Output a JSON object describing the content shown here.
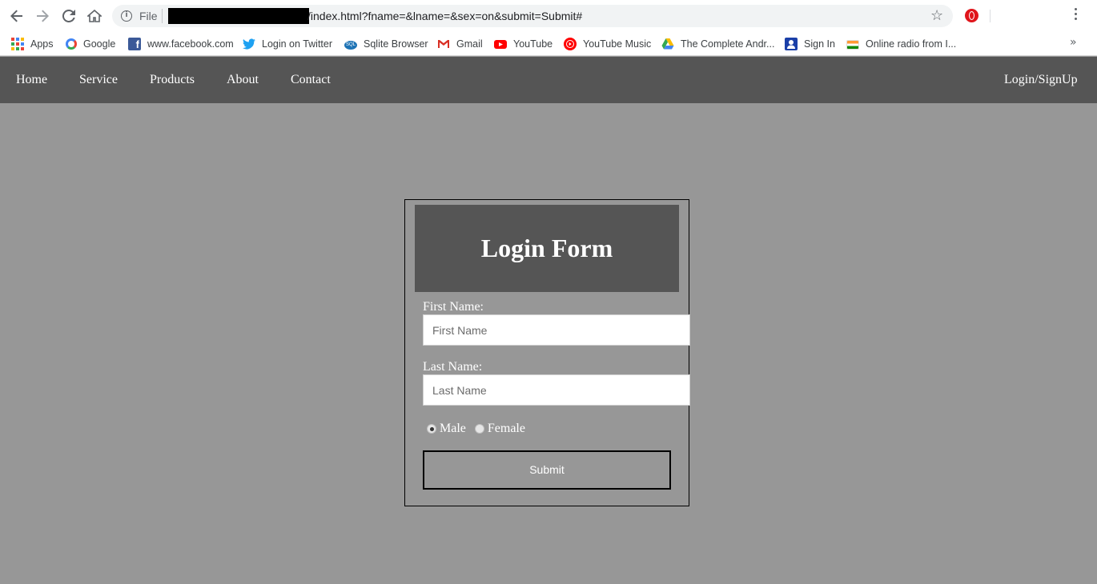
{
  "browser": {
    "file_label": "File",
    "url": "/index.html?fname=&lname=&sex=on&submit=Submit#",
    "bookmarks": [
      {
        "label": "Apps",
        "icon": "apps-grid-icon"
      },
      {
        "label": "Google",
        "icon": "google-icon"
      },
      {
        "label": "www.facebook.com",
        "icon": "facebook-icon"
      },
      {
        "label": "Login on Twitter",
        "icon": "twitter-icon"
      },
      {
        "label": "Sqlite Browser",
        "icon": "sqlite-icon"
      },
      {
        "label": "Gmail",
        "icon": "gmail-icon"
      },
      {
        "label": "YouTube",
        "icon": "youtube-icon"
      },
      {
        "label": "YouTube Music",
        "icon": "youtube-music-icon"
      },
      {
        "label": "The Complete Andr...",
        "icon": "google-drive-icon"
      },
      {
        "label": "Sign In",
        "icon": "sign-in-icon"
      },
      {
        "label": "Online radio from I...",
        "icon": "india-flag-icon"
      }
    ],
    "more_bookmarks": "»"
  },
  "nav": {
    "items": [
      "Home",
      "Service",
      "Products",
      "About",
      "Contact"
    ],
    "login": "Login/SignUp"
  },
  "form": {
    "title": "Login Form",
    "first_name_label": "First Name:",
    "first_name_placeholder": "First Name",
    "last_name_label": "Last Name:",
    "last_name_placeholder": "Last Name",
    "radio_male": "Male",
    "radio_female": "Female",
    "submit": "Submit"
  },
  "colors": {
    "page_bg": "#979797",
    "nav_bg": "#555555",
    "header_bg": "#555555"
  }
}
